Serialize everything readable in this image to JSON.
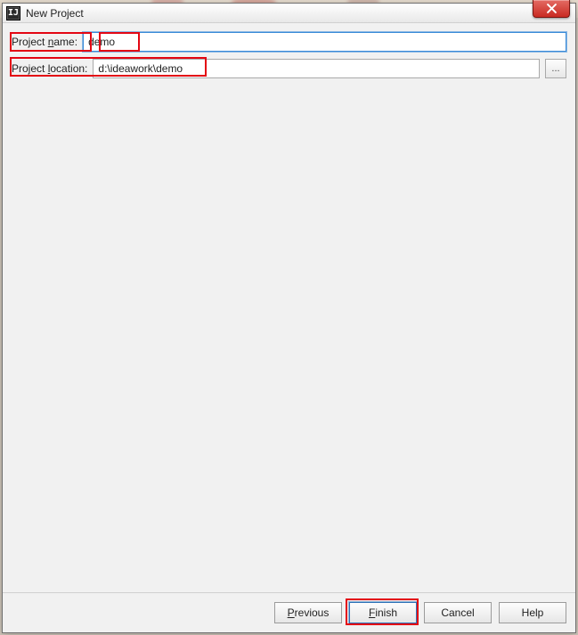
{
  "titlebar": {
    "title": "New Project",
    "close_tooltip": "Close"
  },
  "form": {
    "name_label_prefix": "Project ",
    "name_label_ul": "n",
    "name_label_suffix": "ame:",
    "name_value": "demo",
    "location_label_prefix": "Project ",
    "location_label_ul": "l",
    "location_label_suffix": "ocation:",
    "location_value": "d:\\ideawork\\demo",
    "browse_label": "..."
  },
  "buttons": {
    "previous_ul": "P",
    "previous_rest": "revious",
    "finish_ul": "F",
    "finish_rest": "inish",
    "cancel": "Cancel",
    "help": "Help"
  }
}
